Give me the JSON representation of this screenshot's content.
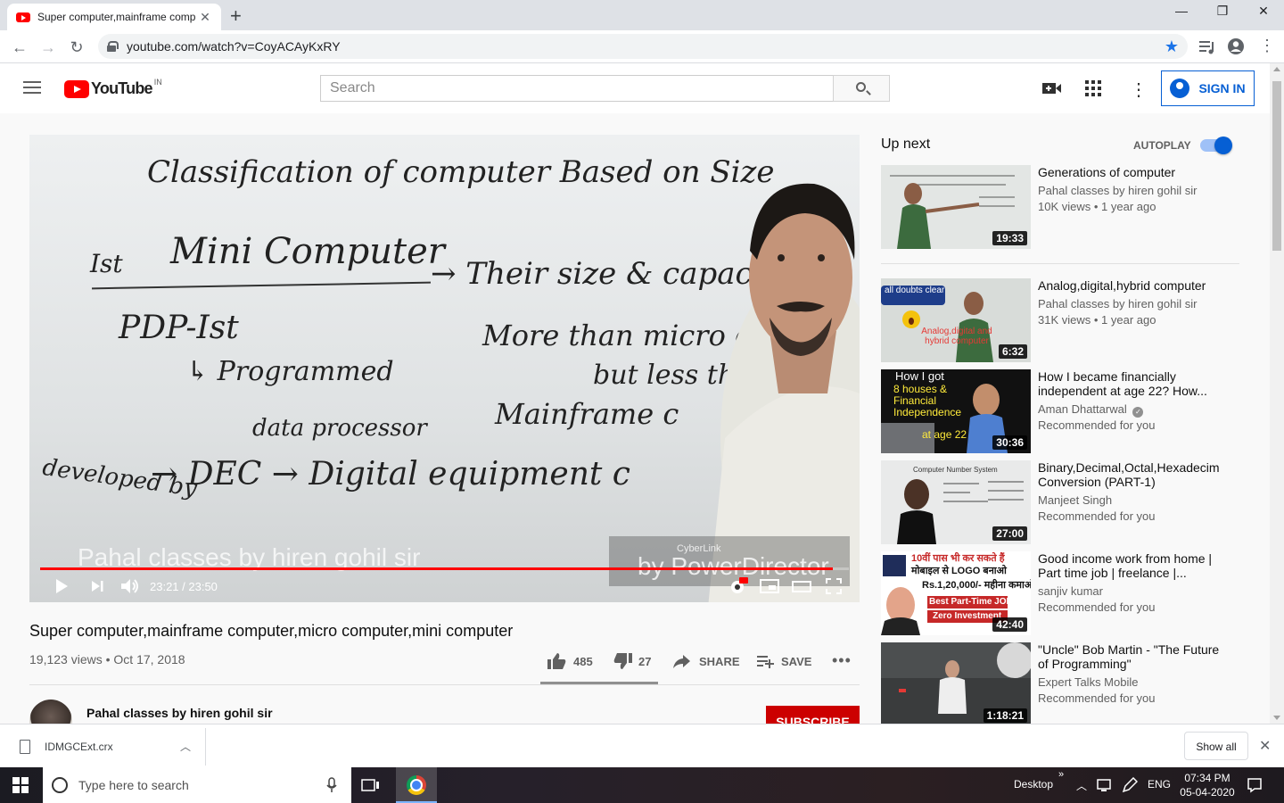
{
  "browser": {
    "tab_title": "Super computer,mainframe comp",
    "url": "youtube.com/watch?v=CoyACAyKxRY"
  },
  "youtube": {
    "logo_word": "YouTube",
    "logo_country": "IN",
    "search_placeholder": "Search",
    "sign_in": "SIGN IN"
  },
  "player": {
    "watermark": "Pahal classes by hiren gohil sir",
    "badge_top": "CyberLink",
    "badge_main": "by PowerDirector",
    "time": "23:21 / 23:50",
    "progress": 0.98,
    "board_lines": {
      "l1": "Classification of computer Based on Size",
      "l2a": "Ist",
      "l2b": "Mini Computer",
      "l2c": "→ Their size & capac",
      "l3a": "PDP-Ist",
      "l3b": "More than micro com",
      "l4a": "↳ Programmed",
      "l4b": "but less th",
      "l5a": "data processor",
      "l5b": "Mainframe c",
      "l6a": "developed by",
      "l6b": "→ DEC → Digital equipment c"
    }
  },
  "video": {
    "title": "Super computer,mainframe computer,micro computer,mini computer",
    "meta": "19,123 views • Oct 17, 2018",
    "likes": "485",
    "dislikes": "27",
    "share": "SHARE",
    "save": "SAVE",
    "channel": "Pahal classes by hiren gohil sir",
    "subscribe": "SUBSCRIBE"
  },
  "sidebar": {
    "up_next": "Up next",
    "autoplay": "AUTOPLAY",
    "items": [
      {
        "title": "Generations of computer",
        "channel": "Pahal classes by hiren gohil sir",
        "info": "10K views • 1 year ago",
        "duration": "19:33"
      },
      {
        "title": "Analog,digital,hybrid computer",
        "channel": "Pahal classes by hiren gohil sir",
        "info": "31K views • 1 year ago",
        "duration": "6:32",
        "thumb_text": "all doubts clear",
        "thumb_text2": "Analog,digital and hybrid computer"
      },
      {
        "title": "How I became financially independent at age 22? How...",
        "channel": "Aman Dhattarwal",
        "info": "Recommended for you",
        "duration": "30:36",
        "thumb_text": "How I got",
        "thumb_text2": "8 houses & Financial Independence",
        "thumb_text3": "at age 22"
      },
      {
        "title": "Binary,Decimal,Octal,Hexadecim Conversion (PART-1)",
        "channel": "Manjeet Singh",
        "info": "Recommended for you",
        "duration": "27:00",
        "thumb_text": "Computer Number System"
      },
      {
        "title": "Good income work from home | Part time job | freelance |...",
        "channel": "sanjiv kumar",
        "info": "Recommended for you",
        "duration": "42:40",
        "thumb_text": "10वीं पास भी कर सकते हैं",
        "thumb_text2": "मोबाइल से LOGO बनाओ",
        "thumb_text3": "Rs.1,20,000/- महीना कमाओ",
        "thumb_text4": "Best Part-Time JOB",
        "thumb_text5": "Zero Investment"
      },
      {
        "title": "\"Uncle\" Bob Martin - \"The Future of Programming\"",
        "channel": "Expert Talks Mobile",
        "info": "Recommended for you",
        "duration": "1:18:21"
      }
    ]
  },
  "downloads": {
    "file": "IDMGCExt.crx",
    "show_all": "Show all"
  },
  "taskbar": {
    "search": "Type here to search",
    "desktop": "Desktop",
    "lang": "ENG",
    "time": "07:34 PM",
    "date": "05-04-2020"
  },
  "colors": {
    "youtube_red": "#ff0000",
    "link_blue": "#065fd4",
    "subscribe_red": "#cc0000"
  }
}
